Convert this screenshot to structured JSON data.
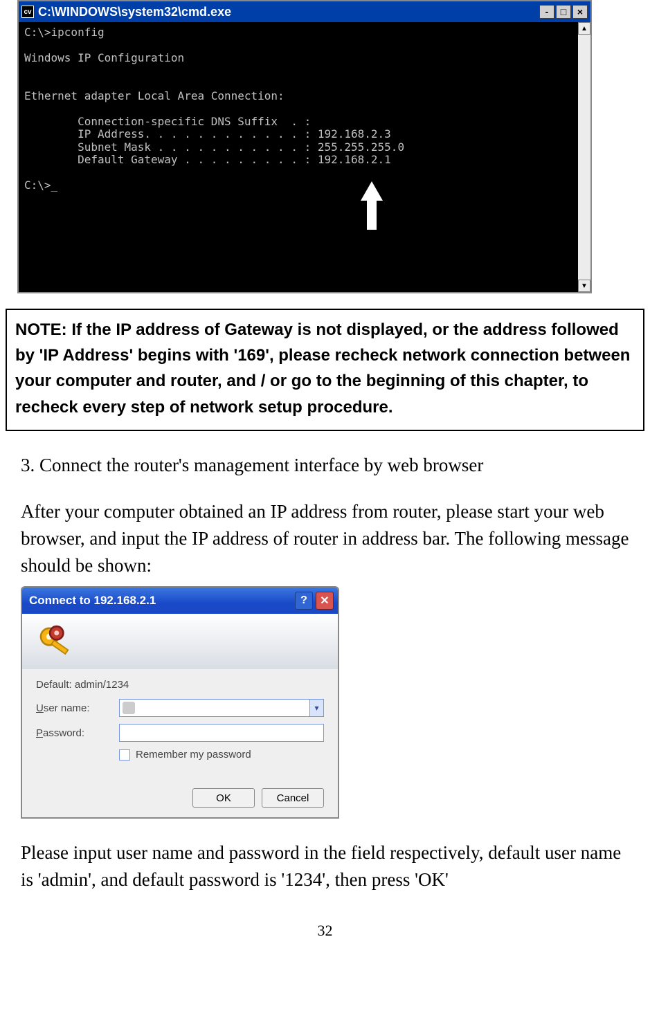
{
  "cmd": {
    "title": "C:\\WINDOWS\\system32\\cmd.exe",
    "icon_label": "cv",
    "lines": "C:\\>ipconfig\n\nWindows IP Configuration\n\n\nEthernet adapter Local Area Connection:\n\n        Connection-specific DNS Suffix  . :\n        IP Address. . . . . . . . . . . . : 192.168.2.3\n        Subnet Mask . . . . . . . . . . . : 255.255.255.0\n        Default Gateway . . . . . . . . . : 192.168.2.1\n\nC:\\>_",
    "btns": {
      "min": "-",
      "max": "□",
      "close": "×"
    },
    "scroll": {
      "up": "▲",
      "down": "▼"
    }
  },
  "note": "NOTE: If the IP address of Gateway is not displayed, or the address followed by 'IP Address' begins with '169', please recheck network connection between your computer and router, and / or go to the beginning of this chapter, to recheck every step of network setup procedure.",
  "step": {
    "title": "3. Connect the router's management interface by web browser",
    "para": "After your computer obtained an IP address from router, please start your web browser, and input the IP address of router in address bar. The following message should be shown:"
  },
  "dlg": {
    "title": "Connect to 192.168.2.1",
    "hint": "Default: admin/1234",
    "user_label": "User name:",
    "pass_label": "Password:",
    "remember": "Remember my password",
    "ok": "OK",
    "cancel": "Cancel"
  },
  "after": "Please input user name and password in the field respectively, default user name is 'admin', and default password is '1234', then press 'OK'",
  "page_number": "32"
}
